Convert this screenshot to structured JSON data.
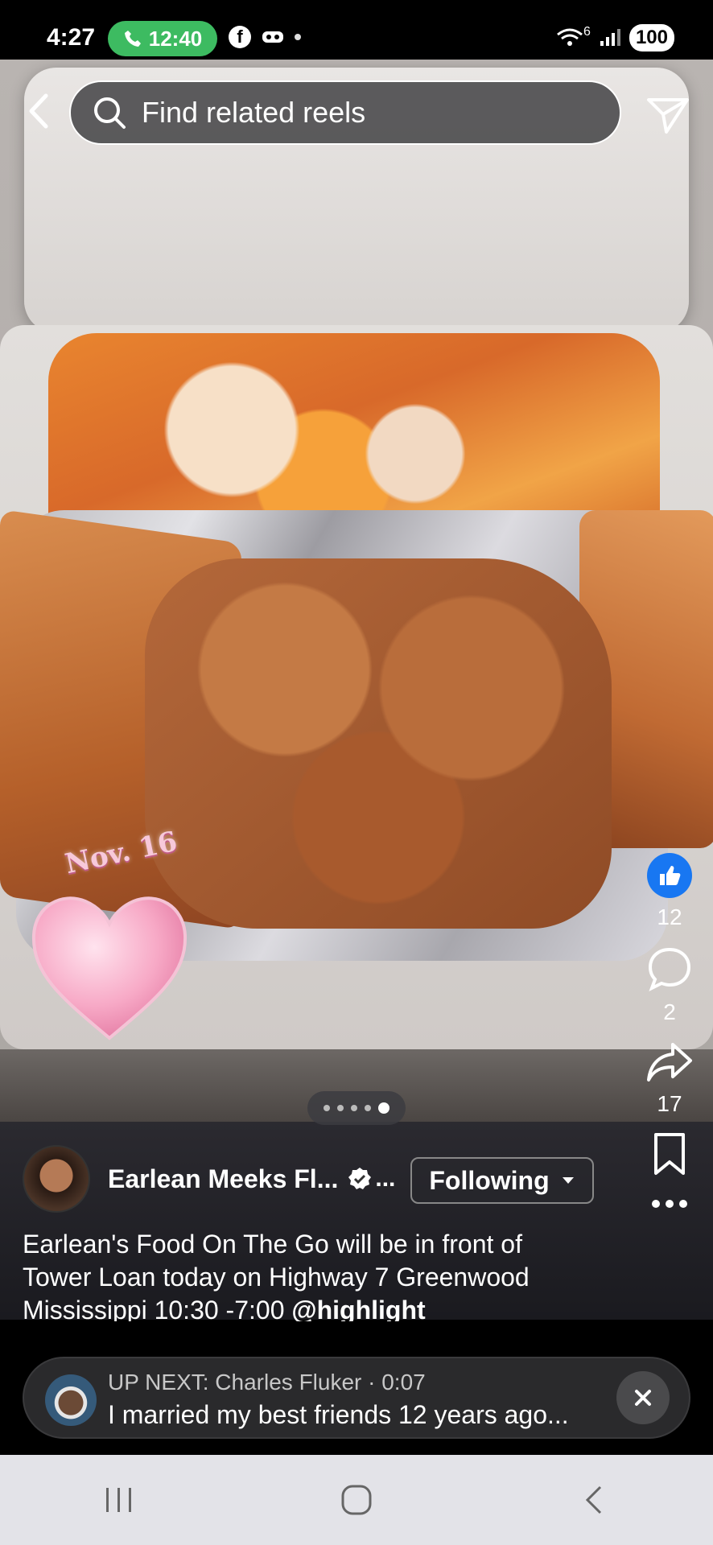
{
  "status_bar": {
    "time": "4:27",
    "call_timer": "12:40",
    "facebook_glyph": "f",
    "network": "6",
    "battery": "100"
  },
  "top_bar": {
    "search_placeholder": "Find related reels"
  },
  "media": {
    "overlay_date": "Nov. 16"
  },
  "actions": {
    "likes": "12",
    "comments": "2",
    "shares": "17"
  },
  "pager": {
    "pages": 5,
    "active_index": 4
  },
  "author": {
    "name": "Earlean Meeks Fl...",
    "ellipsis": "...",
    "follow_label": "Following"
  },
  "caption": {
    "text": "Earlean's Food On The Go will be in front of Tower Loan today on Highway 7 Greenwood Mississippi 10:30 -7:00 ",
    "mention": "@highlight"
  },
  "up_next": {
    "label": "UP NEXT: Charles Fluker · 0:07",
    "title": "I married my best friends 12 years ago..."
  },
  "colors": {
    "like_blue": "#1877f2",
    "call_green": "#3dbb61",
    "nav_bg": "#e3e3e8"
  }
}
